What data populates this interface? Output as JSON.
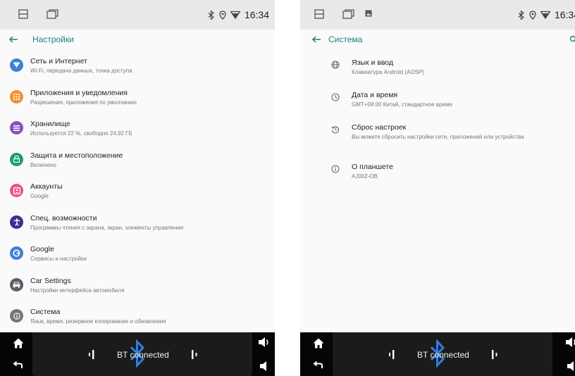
{
  "status_bar": {
    "time": "16:34"
  },
  "left": {
    "title": "Настройки",
    "items": [
      {
        "title": "Сеть и Интернет",
        "subtitle": "Wi-Fi, передача данных, точка доступа",
        "icon": "wifi-icon",
        "color": "#3f7fd6"
      },
      {
        "title": "Приложения и уведомления",
        "subtitle": "Разрешения, приложения по умолчанию",
        "icon": "apps-icon",
        "color": "#f29330"
      },
      {
        "title": "Хранилище",
        "subtitle": "Используется 22 %, свободно 24,92 ГБ",
        "icon": "storage-icon",
        "color": "#7e57c2"
      },
      {
        "title": "Защита и местоположение",
        "subtitle": "Включено",
        "icon": "lock-icon",
        "color": "#1e9e63"
      },
      {
        "title": "Аккаунты",
        "subtitle": "Google",
        "icon": "accounts-icon",
        "color": "#e8577d"
      },
      {
        "title": "Спец. возможности",
        "subtitle": "Программы чтения с экрана, экран, элементы управления",
        "icon": "accessibility-icon",
        "color": "#3b2f8f"
      },
      {
        "title": "Google",
        "subtitle": "Сервисы и настройки",
        "icon": "google-icon",
        "color": "#3f7fd6"
      },
      {
        "title": "Car Settings",
        "subtitle": "Настройки интерфейса автомобиля",
        "icon": "car-icon",
        "color": "#56606a"
      },
      {
        "title": "Система",
        "subtitle": "Язык, время, резервное копирование и обновления",
        "icon": "info-icon",
        "color": "#757575"
      }
    ]
  },
  "right": {
    "title": "Система",
    "items": [
      {
        "title": "Язык и ввод",
        "subtitle": "Клавиатура Android (AOSP)",
        "icon": "globe-icon"
      },
      {
        "title": "Дата и время",
        "subtitle": "GMT+08:00 Китай, стандартное время",
        "icon": "clock-icon"
      },
      {
        "title": "Сброс настроек",
        "subtitle": "Вы можете сбросить настройки сети, приложений или устройства",
        "icon": "reset-icon"
      },
      {
        "title": "О планшете",
        "subtitle": "AJ002-OB",
        "icon": "info-icon"
      }
    ]
  },
  "nav": {
    "bt_status": "BT connected"
  },
  "colors": {
    "accent": "#1a7f7a",
    "status_bar": "#e9e9e9",
    "nav_bar": "#050505",
    "bluetooth": "#2f7fe0"
  }
}
